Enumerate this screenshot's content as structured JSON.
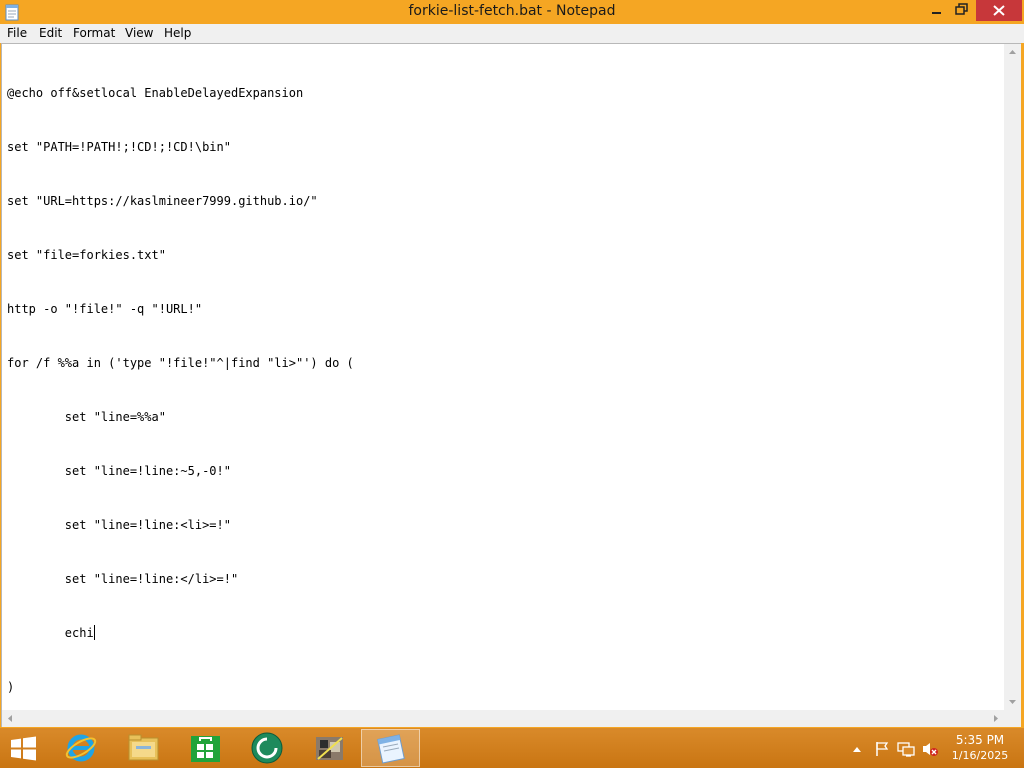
{
  "window": {
    "title": "forkie-list-fetch.bat - Notepad"
  },
  "menu": [
    "File",
    "Edit",
    "Format",
    "View",
    "Help"
  ],
  "editor": {
    "lines": [
      "@echo off&setlocal EnableDelayedExpansion",
      "set \"PATH=!PATH!;!CD!;!CD!\\bin\"",
      "set \"URL=https://kaslmineer7999.github.io/\"",
      "set \"file=forkies.txt\"",
      "http -o \"!file!\" -q \"!URL!\"",
      "for /f %%a in ('type \"!file!\"^|find \"li>\"') do (",
      "        set \"line=%%a\"",
      "        set \"line=!line:~5,-0!\"",
      "        set \"line=!line:<li>=!\"",
      "        set \"line=!line:</li>=!\"",
      "        echi",
      ")"
    ]
  },
  "taskbar": {
    "pinned": [
      "Internet Explorer",
      "File Explorer",
      "Store",
      "Browser",
      "Game",
      "Notepad"
    ],
    "active_app": "Notepad"
  },
  "tray": {
    "icons": [
      "show-hidden-icons-icon",
      "action-center-flag-icon",
      "network-icon",
      "volume-muted-icon"
    ]
  },
  "clock": {
    "time": "5:35 PM",
    "date": "1/16/2025"
  },
  "colors": {
    "window_frame": "#f5a623",
    "taskbar": "#d98a2a",
    "close_button": "#c7373a"
  }
}
